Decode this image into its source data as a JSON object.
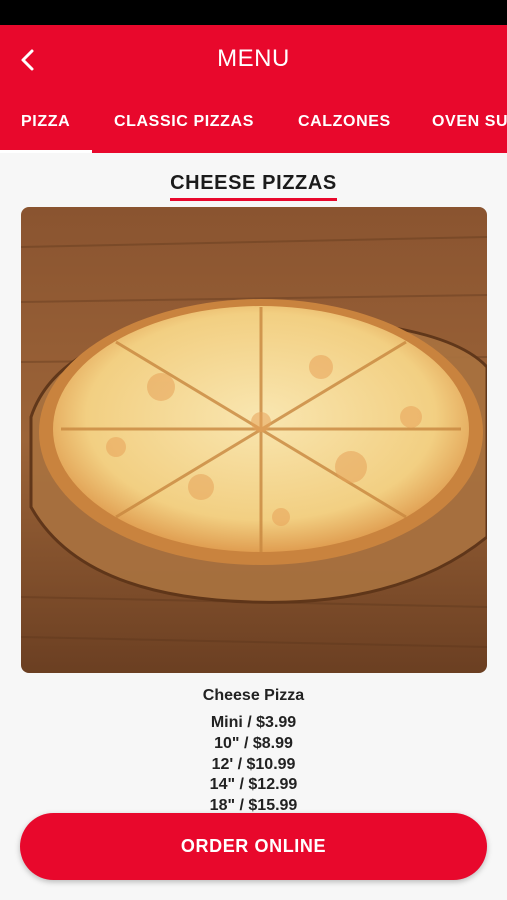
{
  "header": {
    "title": "MENU",
    "back_icon": "chevron-left-icon"
  },
  "tabs": [
    {
      "label": "PIZZA",
      "active": true
    },
    {
      "label": "CLASSIC PIZZAS",
      "active": false
    },
    {
      "label": "CALZONES",
      "active": false
    },
    {
      "label": "OVEN SU",
      "active": false
    }
  ],
  "section": {
    "title": "CHEESE PIZZAS"
  },
  "item": {
    "name": "Cheese Pizza",
    "prices": [
      "Mini / $3.99",
      "10\" / $8.99",
      "12' / $10.99",
      "14\" / $12.99",
      "18\" / $15.99"
    ]
  },
  "actions": {
    "order_label": "ORDER ONLINE"
  },
  "colors": {
    "brand_red": "#e8082c",
    "background": "#f7f7f7"
  }
}
